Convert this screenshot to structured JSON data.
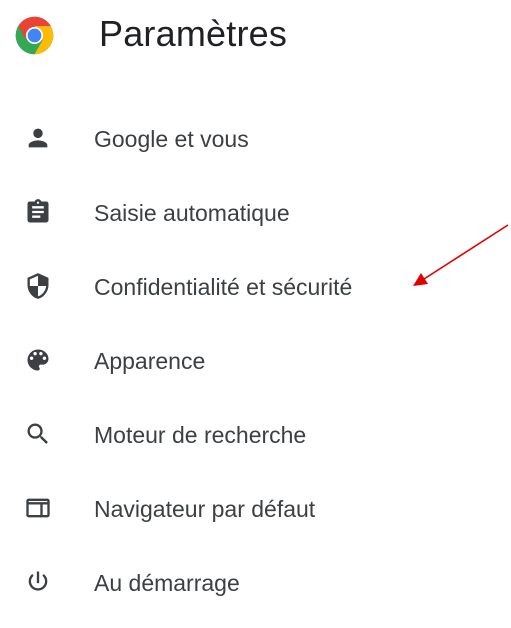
{
  "header": {
    "title": "Paramètres",
    "logo_icon": "chrome-logo-icon"
  },
  "menu": {
    "items": [
      {
        "label": "Google et vous",
        "icon": "person-icon"
      },
      {
        "label": "Saisie automatique",
        "icon": "clipboard-icon"
      },
      {
        "label": "Confidentialité et sécurité",
        "icon": "shield-icon"
      },
      {
        "label": "Apparence",
        "icon": "palette-icon"
      },
      {
        "label": "Moteur de recherche",
        "icon": "search-icon"
      },
      {
        "label": "Navigateur par défaut",
        "icon": "browser-window-icon"
      },
      {
        "label": "Au démarrage",
        "icon": "power-icon"
      }
    ]
  },
  "annotation": {
    "type": "arrow",
    "color": "#e00000",
    "points_to": "Confidentialité et sécurité"
  },
  "colors": {
    "title": "#202124",
    "label": "#3c4043",
    "icon": "#3c4043",
    "background": "#ffffff"
  }
}
